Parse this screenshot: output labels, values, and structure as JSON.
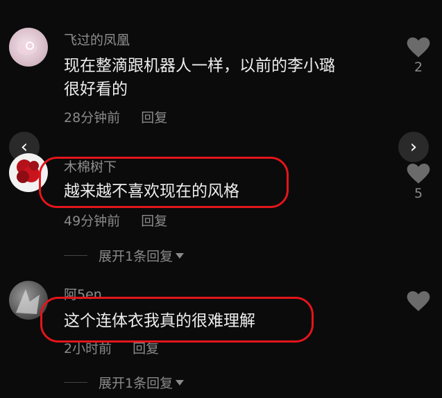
{
  "comments": [
    {
      "username": "飞过的凤凰",
      "text_lines": [
        "现在整滴跟机器人一样，以前的李小璐",
        "很好看的"
      ],
      "time": "28分钟前",
      "reply_label": "回复",
      "likes": "2"
    },
    {
      "username": "木棉树下",
      "text_lines": [
        "越来越不喜欢现在的风格"
      ],
      "time": "49分钟前",
      "reply_label": "回复",
      "likes": "5",
      "expand_label": "展开1条回复"
    },
    {
      "username": "阿5en",
      "text_lines": [
        "这个连体衣我真的很难理解"
      ],
      "time": "2小时前",
      "reply_label": "回复",
      "likes": "",
      "expand_label": "展开1条回复"
    }
  ],
  "nav": {
    "prev": "‹",
    "next": "›"
  },
  "colors": {
    "background": "#0b0b0b",
    "highlight": "#e4151b",
    "muted": "#8a8a8a"
  }
}
